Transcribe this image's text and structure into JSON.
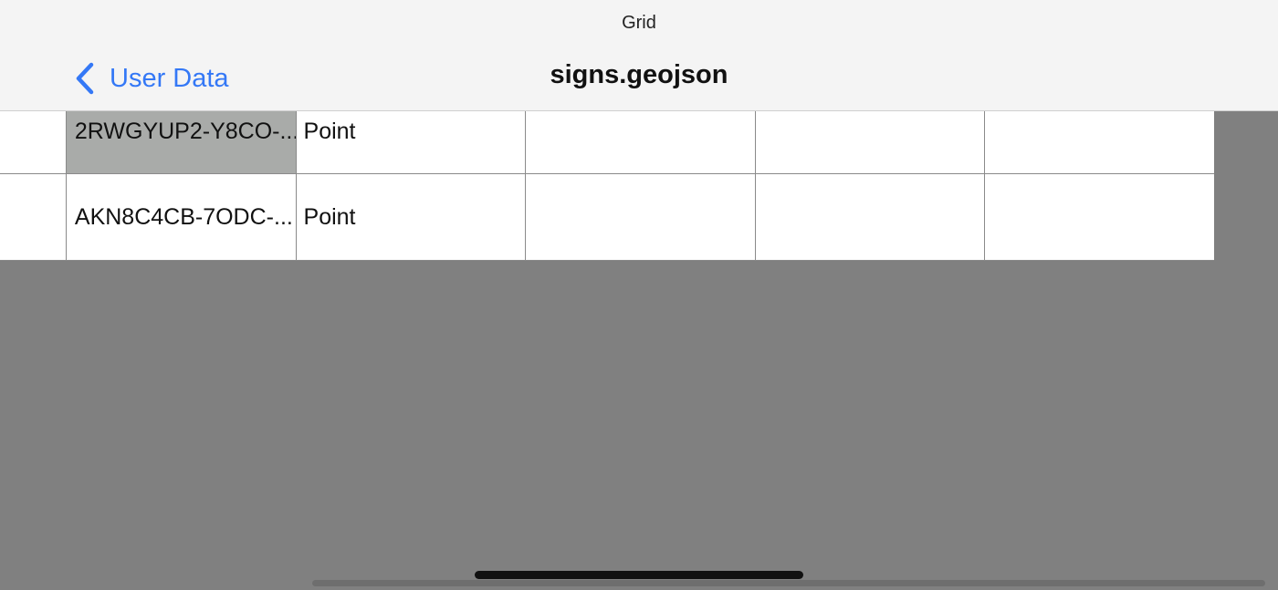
{
  "window": {
    "title": "Grid"
  },
  "navbar": {
    "back_label": "User Data",
    "back_icon": "chevron-left-icon",
    "title": "signs.geojson"
  },
  "grid": {
    "rows": [
      {
        "id": "2RWGYUP2-Y8CO-...",
        "type": "Point",
        "selected": true
      },
      {
        "id": "AKN8C4CB-7ODC-...",
        "type": "Point",
        "selected": false
      }
    ]
  },
  "colors": {
    "accent": "#3478f6",
    "background": "#808080",
    "selected_cell": "#a9aba9",
    "navbar": "#f4f4f4"
  }
}
